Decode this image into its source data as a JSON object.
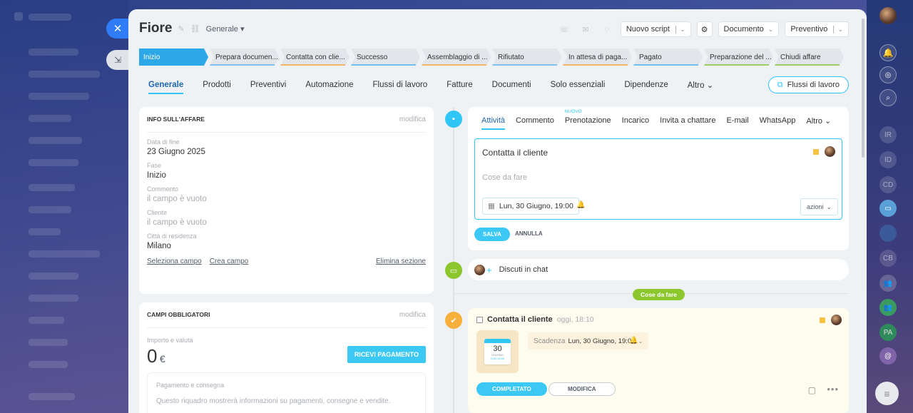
{
  "header": {
    "title": "Fiore",
    "category": "Generale",
    "buttons": {
      "nuovo_script": "Nuovo script",
      "documento": "Documento",
      "preventivo": "Preventivo"
    }
  },
  "stages": [
    {
      "label": "Inizio",
      "color": "#2ca7e7"
    },
    {
      "label": "Prepara documen...",
      "color": "#7fc2ec"
    },
    {
      "label": "Contatta con clie...",
      "color": "#f4b76a"
    },
    {
      "label": "Successo",
      "color": "#6fc0ec"
    },
    {
      "label": "Assemblaggio di ...",
      "color": "#f4b76a"
    },
    {
      "label": "Rifiutato",
      "color": "#7fc2ec"
    },
    {
      "label": "In attesa di paga...",
      "color": "#f4b76a"
    },
    {
      "label": "Pagato",
      "color": "#6fc0ec"
    },
    {
      "label": "Preparazione del ...",
      "color": "#9bd064"
    },
    {
      "label": "Chiudi affare",
      "color": "#9bd064"
    }
  ],
  "tabs": [
    "Generale",
    "Prodotti",
    "Preventivi",
    "Automazione",
    "Flussi di lavoro",
    "Fatture",
    "Documenti",
    "Solo essenziali",
    "Dipendenze",
    "Altro"
  ],
  "flows_button": "Flussi di lavoro",
  "info_card": {
    "title": "INFO SULL'AFFARE",
    "edit": "modifica",
    "fields": [
      {
        "label": "Data di fine",
        "value": "23 Giugno 2025",
        "empty": false
      },
      {
        "label": "Fase",
        "value": "Inizio",
        "empty": false
      },
      {
        "label": "Commento",
        "value": "il campo è vuoto",
        "empty": true
      },
      {
        "label": "Cliente",
        "value": "il campo è vuoto",
        "empty": true
      },
      {
        "label": "Città di residenza",
        "value": "Milano",
        "empty": false
      }
    ],
    "links": {
      "select": "Seleziona campo",
      "create": "Crea campo",
      "delete": "Elimina sezione"
    }
  },
  "required_card": {
    "title": "CAMPI OBBLIGATORI",
    "edit": "modifica",
    "amount_label": "Importo e valuta",
    "amount": "0",
    "currency": "€",
    "pay_button": "RICEVI PAGAMENTO",
    "sub_title": "Pagamento e consegna",
    "sub_text": "Questo riquadro mostrerà informazioni su pagamenti, consegne e vendite."
  },
  "activity": {
    "tabs": [
      "Attività",
      "Commento",
      "Prenotazione",
      "Incarico",
      "Invita a chattare",
      "E-mail",
      "WhatsApp",
      "Altro"
    ],
    "new_badge": "NUOVO",
    "editor_title": "Contatta il cliente",
    "placeholder": "Cose da fare",
    "date": "Lun, 30 Giugno, 19:00",
    "actions": "azioni",
    "save": "SALVA",
    "cancel": "ANNULLA"
  },
  "chat": {
    "label": "Discuti in chat"
  },
  "todo_badge": "Cose da fare",
  "todo": {
    "title": "Contatta il cliente",
    "time": "oggi, 18:10",
    "cal_day": "30",
    "cal_month": "GIUGNO",
    "cal_sub": "LUN 19:00",
    "deadline_label": "Scadenza",
    "deadline": "Lun, 30 Giugno, 19:00",
    "complete": "COMPLETATO",
    "modify": "MODIFICA"
  },
  "colors": {
    "accent": "#2fc6f6",
    "primary_blue": "#2067b0",
    "todo_bg": "#fefcee",
    "green": "#8bc72d",
    "orange": "#f7b03b"
  },
  "dock": [
    "IR",
    "ID",
    "CD",
    "CB",
    "PA"
  ]
}
